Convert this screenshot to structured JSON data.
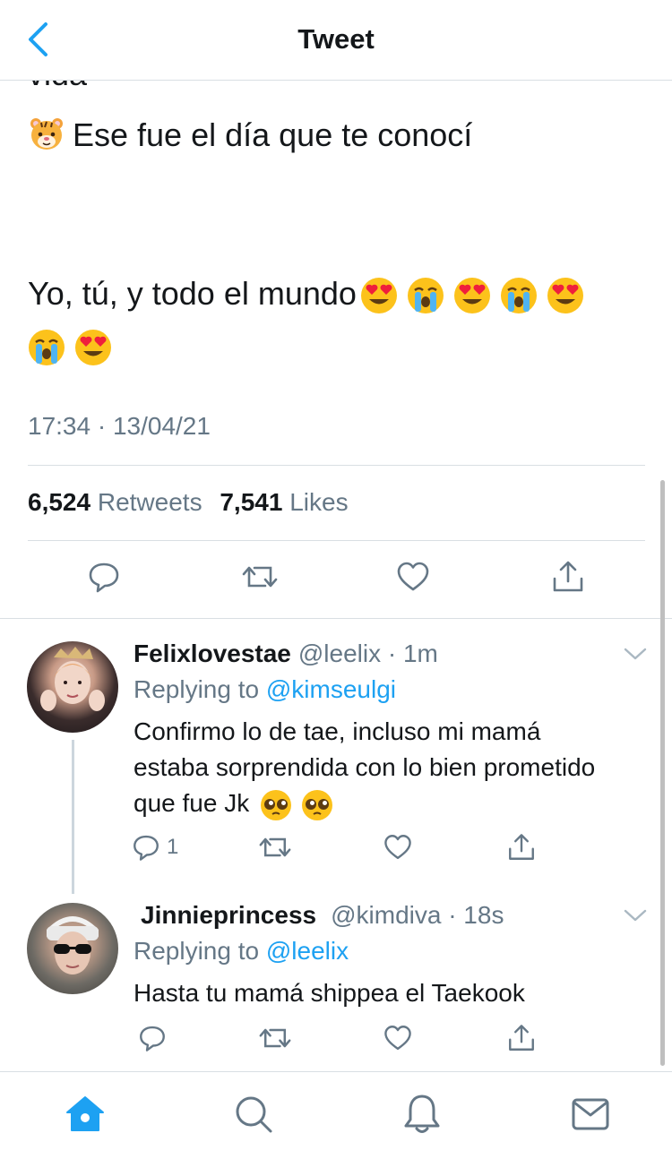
{
  "header": {
    "title": "Tweet"
  },
  "tweet": {
    "clipped_text": "vida",
    "line_tiger": "Ese fue el día que te conocí",
    "line_main": "Yo, tú, y todo el mundo",
    "timestamp": "17:34 · 13/04/21",
    "retweets_count": "6,524",
    "retweets_label": "Retweets",
    "likes_count": "7,541",
    "likes_label": "Likes"
  },
  "replies": [
    {
      "name": "Felixlovestae",
      "handle": "@leelix · 1m",
      "replying_prefix": "Replying to",
      "replying_to": "@kimseulgi",
      "text_line1": "Confirmo lo de tae, incluso mi mamá",
      "text_line2": "estaba sorprendida con lo bien prometido",
      "text_line3": "que fue Jk",
      "reply_count": "1"
    },
    {
      "name": "Jinnieprincess",
      "handle": "@kimdiva · 18s",
      "replying_prefix": "Replying to",
      "replying_to": "@leelix",
      "text_line1": "Hasta tu mamá shippea el Taekook"
    }
  ],
  "icons": [
    "back-chevron-icon",
    "reply-icon",
    "retweet-icon",
    "like-icon",
    "share-icon",
    "home-icon",
    "search-icon",
    "notifications-icon",
    "messages-icon"
  ],
  "colors": {
    "accent": "#1da1f2",
    "text": "#14171a",
    "muted": "#657786",
    "divider": "#d9dfe3"
  }
}
